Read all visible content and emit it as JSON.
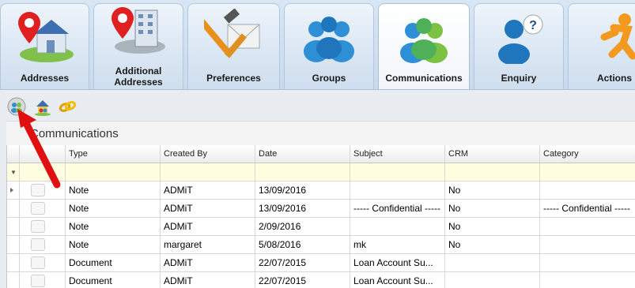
{
  "tabs": [
    {
      "label": "Addresses",
      "icon": "house-pin-icon",
      "active": false
    },
    {
      "label": "Additional Addresses",
      "icon": "building-pin-icon",
      "active": false
    },
    {
      "label": "Preferences",
      "icon": "tools-envelope-icon",
      "active": false
    },
    {
      "label": "Groups",
      "icon": "people-group-icon",
      "active": false
    },
    {
      "label": "Communications",
      "icon": "people-communication-icon",
      "active": true
    },
    {
      "label": "Enquiry",
      "icon": "person-question-icon",
      "active": false
    },
    {
      "label": "Actions",
      "icon": "running-person-icon",
      "active": false
    }
  ],
  "toolbar": {
    "buttons": [
      "add-communication-icon",
      "people-house-icon",
      "link-chain-icon"
    ]
  },
  "panel": {
    "title": "Communications"
  },
  "grid": {
    "columns": [
      "",
      "",
      "Type",
      "Created By",
      "Date",
      "Subject",
      "CRM",
      "Category"
    ],
    "rows": [
      {
        "type": "Note",
        "created_by": "ADMiT",
        "date": "13/09/2016",
        "subject": "",
        "crm": "No",
        "category": ""
      },
      {
        "type": "Note",
        "created_by": "ADMiT",
        "date": "13/09/2016",
        "subject": "----- Confidential -----",
        "crm": "No",
        "category": "----- Confidential -----"
      },
      {
        "type": "Note",
        "created_by": "ADMiT",
        "date": "2/09/2016",
        "subject": "",
        "crm": "No",
        "category": ""
      },
      {
        "type": "Note",
        "created_by": "margaret",
        "date": "5/08/2016",
        "subject": "mk",
        "crm": "No",
        "category": ""
      },
      {
        "type": "Document",
        "created_by": "ADMiT",
        "date": "22/07/2015",
        "subject": "Loan Account Su...",
        "crm": "",
        "category": ""
      },
      {
        "type": "Document",
        "created_by": "ADMiT",
        "date": "22/07/2015",
        "subject": "Loan Account Su...",
        "crm": "",
        "category": ""
      }
    ]
  },
  "colors": {
    "arrow": "#e01010",
    "filter_row": "#fffee0",
    "tab_bg": "#d9e6f3"
  }
}
